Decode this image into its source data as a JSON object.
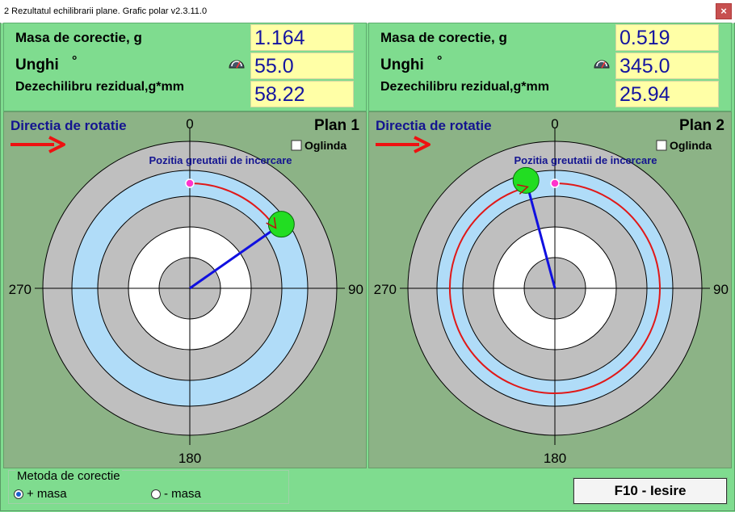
{
  "window": {
    "title": "2 Rezultatul echilibrarii plane. Grafic polar v2.3.11.0",
    "close_glyph": "×"
  },
  "planes": [
    {
      "mass_label": "Masa de corectie, g",
      "mass_value": "1.164",
      "angle_label": "Unghi",
      "angle_unit": "°",
      "angle_value": "55.0",
      "residual_label": "Dezechilibru rezidual,g*mm",
      "residual_value": "58.22",
      "rotation_label": "Directia de rotatie",
      "plane_label": "Plan 1",
      "mirror_label": "Oglinda",
      "trial_weight_label": "Pozitia greutatii de incercare",
      "ticks": {
        "top": "0",
        "right": "90",
        "bottom": "180",
        "left": "270"
      },
      "correction_angle_deg": 55,
      "correction_magnitude": 0.76,
      "trial_angle_deg": 0
    },
    {
      "mass_label": "Masa de corectie, g",
      "mass_value": "0.519",
      "angle_label": "Unghi",
      "angle_unit": "°",
      "angle_value": "345.0",
      "residual_label": "Dezechilibru rezidual,g*mm",
      "residual_value": "25.94",
      "rotation_label": "Directia de rotatie",
      "plane_label": "Plan 2",
      "mirror_label": "Oglinda",
      "trial_weight_label": "Pozitia greutatii de incercare",
      "ticks": {
        "top": "0",
        "right": "90",
        "bottom": "180",
        "left": "270"
      },
      "correction_angle_deg": 345,
      "correction_magnitude": 0.76,
      "trial_angle_deg": 0
    }
  ],
  "correction_method": {
    "legend": "Metoda de corectie",
    "plus_label": "+ masa",
    "minus_label": "- masa",
    "selected": "plus"
  },
  "exit_button": {
    "label": "F10 - Iesire"
  },
  "colors": {
    "ring_gray": "#bfbfbf",
    "ring_blue": "#b0dcf8",
    "ring_white": "#ffffff",
    "arc_red": "#e01818",
    "vector_blue": "#1010e0",
    "weight_green": "#22dd22",
    "trial_magenta": "#ff33cc",
    "arrow_red": "#ee1111"
  },
  "icons": {
    "gauge": "gauge-icon"
  }
}
